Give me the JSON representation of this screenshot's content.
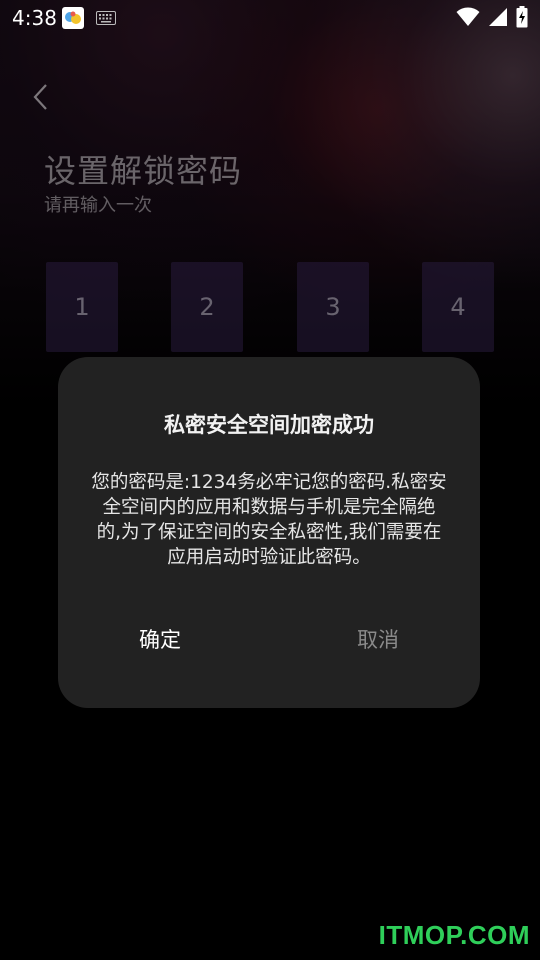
{
  "status_bar": {
    "time": "4:38",
    "icons": [
      "app-notification-icon",
      "keyboard-icon",
      "wifi-icon",
      "cell-signal-icon",
      "battery-charging-icon"
    ]
  },
  "header": {
    "back_icon": "chevron-left-icon",
    "title": "设置解锁密码",
    "subtitle": "请再输入一次"
  },
  "pin": {
    "digits": [
      "1",
      "2",
      "3",
      "4"
    ]
  },
  "dialog": {
    "title": "私密安全空间加密成功",
    "message_lines": [
      "您的密码是:1234务必牢记您的密码.私密安",
      "全空间内的应用和数据与手机是完全隔绝",
      "的,为了保证空间的安全私密性,我们需要在",
      "应用启动时验证此密码。"
    ],
    "confirm_label": "确定",
    "cancel_label": "取消"
  },
  "watermark": {
    "text": "ITMOP.COM",
    "color": "#2fcf5a"
  },
  "colors": {
    "dialog_bg": "#222222",
    "screen_bg": "#000000"
  }
}
